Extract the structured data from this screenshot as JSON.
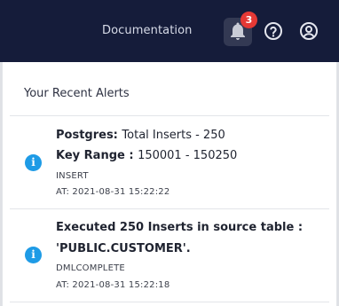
{
  "header": {
    "doc_link": "Documentation",
    "notification_count": "3"
  },
  "colors": {
    "header_bg": "#151c3a",
    "badge": "#e53935",
    "info": "#1e9be6"
  },
  "panel": {
    "title": "Your Recent Alerts",
    "alerts": [
      {
        "icon": "info-icon",
        "source": "Postgres:",
        "message": "Total Inserts - 250",
        "range_label": "Key Range :",
        "range_value": "150001 - 150250",
        "type": "INSERT",
        "time": "AT: 2021-08-31 15:22:22"
      },
      {
        "icon": "info-icon",
        "message_line1": "Executed 250 Inserts in source table :",
        "message_line2": "'PUBLIC.CUSTOMER'.",
        "type": "DMLCOMPLETE",
        "time": "AT: 2021-08-31 15:22:18"
      }
    ]
  }
}
